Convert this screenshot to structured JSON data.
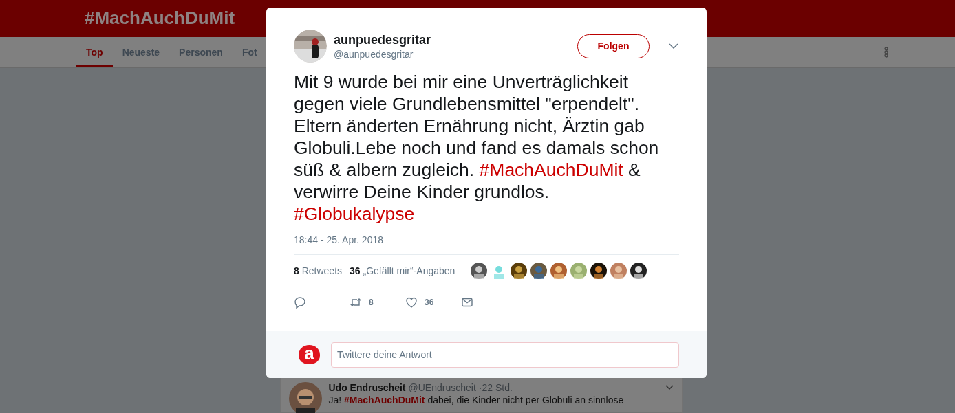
{
  "page": {
    "title": "#MachAuchDuMit",
    "tabs": [
      {
        "label": "Top",
        "selected": true
      },
      {
        "label": "Neueste",
        "selected": false
      },
      {
        "label": "Personen",
        "selected": false
      },
      {
        "label": "Fot",
        "selected": false
      }
    ],
    "background_tweet": {
      "name": "Udo Endruscheit",
      "handle": "@UEndruscheit",
      "time": "·22 Std.",
      "text": [
        {
          "kind": "text",
          "text": "Ja! "
        },
        {
          "kind": "hashtag",
          "text": "#MachAuchDuMit"
        },
        {
          "kind": "text",
          "text": " dabei, die Kinder nicht per Globuli an sinnlose"
        }
      ]
    }
  },
  "tweet": {
    "name": "aunpuedesgritar",
    "handle": "@aunpuedesgritar",
    "follow_button": "Folgen",
    "text": [
      {
        "kind": "text",
        "text": "Mit 9 wurde bei mir eine Unverträglichkeit gegen viele Grundlebensmittel \"erpendelt\". Eltern änderten Ernährung nicht, Ärztin gab Globuli.Lebe noch und fand es damals schon süß & albern zugleich. "
      },
      {
        "kind": "hashtag",
        "text": "#MachAuchDuMit"
      },
      {
        "kind": "text",
        "text": " & verwirre Deine Kinder grundlos. "
      },
      {
        "kind": "hashtag",
        "text": "#Globukalypse"
      }
    ],
    "timestamp": "18:44 - 25. Apr. 2018",
    "stats": [
      {
        "count": "8",
        "label": "Retweets"
      },
      {
        "count": "36",
        "label": "„Gefällt mir“-Angaben"
      }
    ],
    "actions": [
      {
        "kind": "reply"
      },
      {
        "kind": "retweet",
        "count": "8"
      },
      {
        "kind": "like",
        "count": "36"
      },
      {
        "kind": "message"
      }
    ],
    "reply": {
      "avatar_letter": "a",
      "placeholder": "Twittere deine Antwort"
    }
  }
}
